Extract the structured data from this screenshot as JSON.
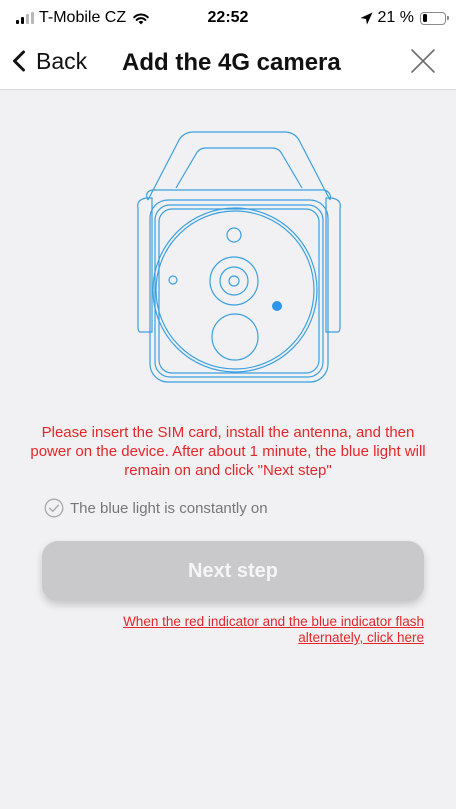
{
  "status_bar": {
    "carrier": "T-Mobile CZ",
    "time": "22:52",
    "battery": "21 %",
    "signal_bars_filled": 2,
    "signal_bars_total": 4,
    "battery_level": 0.21,
    "icons": [
      "signal-icon",
      "wifi-icon",
      "location-arrow-icon",
      "battery-icon"
    ]
  },
  "nav": {
    "back_label": "Back",
    "title": "Add the 4G camera",
    "icons": [
      "back-chevron-icon",
      "close-icon"
    ]
  },
  "main": {
    "illustration": "camera-illustration",
    "instruction": "Please insert the SIM card, install the antenna, and then power on the device. After about 1 minute, the blue light will remain on and click \"Next step\"",
    "checkbox_label": "The blue light is constantly on",
    "checkbox_checked": false,
    "next_button_label": "Next step",
    "flash_link_text": "When the red indicator and the blue indicator flash alternately, click here"
  },
  "colors": {
    "warning_text": "#e5262a",
    "illustration_stroke": "#3aa0e0",
    "indicator_light": "#2d96ea",
    "button_disabled_bg": "#c9c9cb",
    "page_background": "#f1f1f3"
  }
}
